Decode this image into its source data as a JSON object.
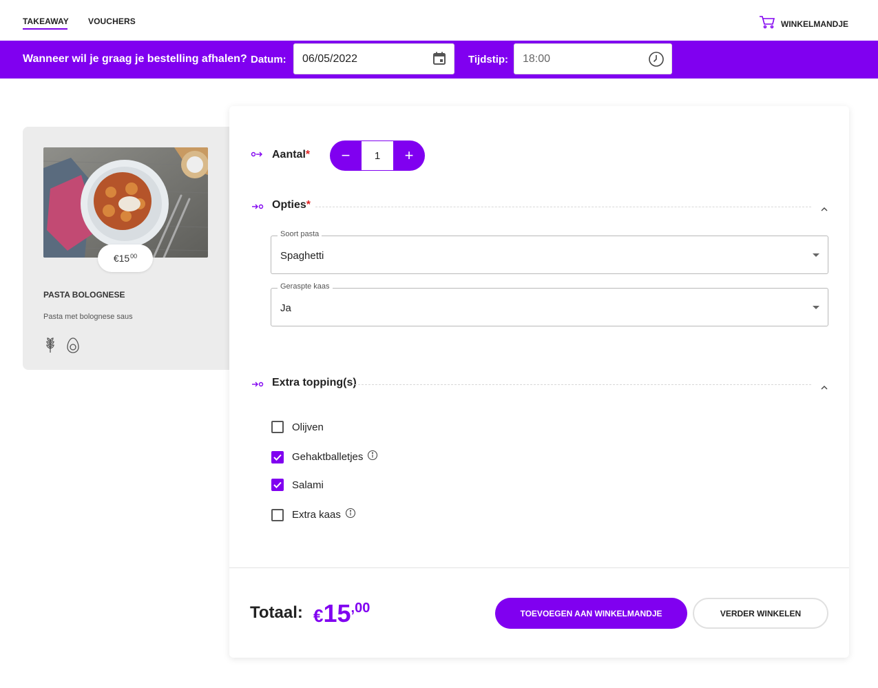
{
  "nav": {
    "tabs": [
      {
        "label": "TAKEAWAY",
        "active": true
      },
      {
        "label": "VOUCHERS",
        "active": false
      }
    ],
    "cart_label": "WINKELMANDJE",
    "cart_icon": "cart-icon"
  },
  "pickup_bar": {
    "question": "Wanneer wil je graag je bestelling afhalen?",
    "date_label": "Datum:",
    "date_value": "06/05/2022",
    "date_icon": "calendar-icon",
    "time_label": "Tijdstip:",
    "time_value": "18:00",
    "time_icon": "clock-icon",
    "background_color": "#8000f0"
  },
  "product": {
    "price_main": "€15",
    "price_cents": "00",
    "title": "PASTA BOLOGNESE",
    "description": "Pasta met bolognese saus",
    "allergen_icons": [
      "wheat-icon",
      "egg-icon"
    ]
  },
  "options_panel": {
    "quantity": {
      "label": "Aantal",
      "required_mark": "*",
      "value": "1",
      "minus": "−",
      "plus": "+"
    },
    "options_section": {
      "title": "Opties",
      "required_mark": "*",
      "fields": [
        {
          "label": "Soort pasta",
          "value": "Spaghetti"
        },
        {
          "label": "Geraspte kaas",
          "value": "Ja"
        }
      ]
    },
    "toppings_section": {
      "title": "Extra topping(s)",
      "items": [
        {
          "label": "Olijven",
          "checked": false,
          "info": false
        },
        {
          "label": "Gehaktballetjes",
          "checked": true,
          "info": true
        },
        {
          "label": "Salami",
          "checked": true,
          "info": false
        },
        {
          "label": "Extra kaas",
          "checked": false,
          "info": true
        }
      ]
    },
    "total": {
      "label": "Totaal:",
      "currency": "€",
      "integer": "15",
      "decimals": ",00"
    },
    "buttons": {
      "add_to_cart": "TOEVOEGEN AAN WINKELMANDJE",
      "continue_shopping": "VERDER WINKELEN"
    }
  },
  "colors": {
    "accent": "#8000f0",
    "required": "#e02020",
    "card_bg": "#ececec"
  }
}
